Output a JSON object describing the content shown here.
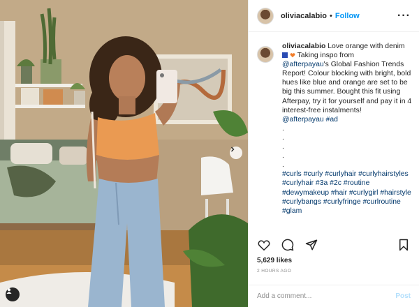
{
  "post": {
    "username": "oliviacalabio",
    "follow_label": "Follow",
    "more_icon": "ellipsis-icon"
  },
  "caption": {
    "username": "oliviacalabio",
    "text1": "Love orange with denim",
    "emojis": [
      "blue-heart-icon",
      "orange-heart-icon"
    ],
    "text2": "Taking inspo from",
    "mention1": "@afterpayau",
    "text3": "'s Global Fashion Trends Report! Colour blocking with bright, bold hues like blue and orange are set to be big this summer. Bought this fit using Afterpay, try it for yourself and pay it in 4 interest-free instalments!",
    "mention2": "@afterpayau",
    "hashtag_ad": "#ad",
    "dots": [
      ".",
      ".",
      ".",
      ".",
      "."
    ],
    "hashtags": "#curls #curly #curlyhair #curlyhairstyles #curlyhair #3a #2c #routine #dewymakeup #hair #curlygirl #hairstyle #curlybangs #curlyfringe #curlroutine #glam"
  },
  "stats": {
    "likes": "5,629 likes",
    "time": "2 HOURS AGO"
  },
  "comment_box": {
    "placeholder": "Add a comment...",
    "post_label": "Post"
  },
  "colors": {
    "link": "#00376b",
    "follow": "#0095f6",
    "post_disabled": "#b2dffc",
    "muted": "#8e8e8e"
  }
}
